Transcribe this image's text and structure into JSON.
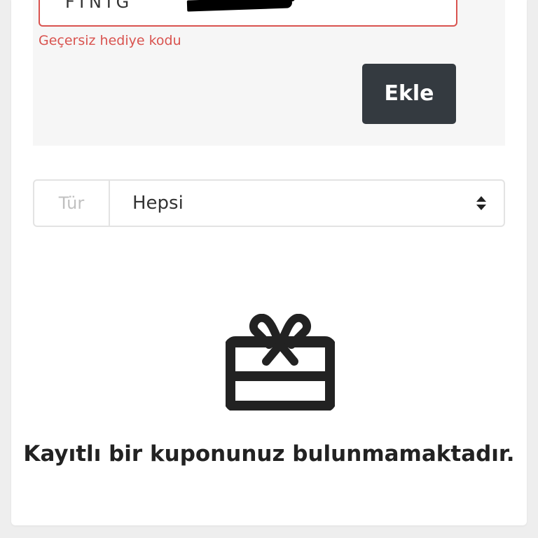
{
  "redeem": {
    "code_value": "FTNTG",
    "error_message": "Geçersiz hediye kodu",
    "add_label": "Ekle",
    "clear_icon": "x-icon"
  },
  "filter": {
    "type_label": "Tür",
    "type_selected": "Hepsi"
  },
  "empty_state": {
    "icon": "gift-icon",
    "message": "Kayıtlı bir kuponunuz bulunmamaktadır."
  },
  "colors": {
    "error": "#d9534f",
    "button": "#343a40",
    "panel": "#f6f6f6"
  }
}
